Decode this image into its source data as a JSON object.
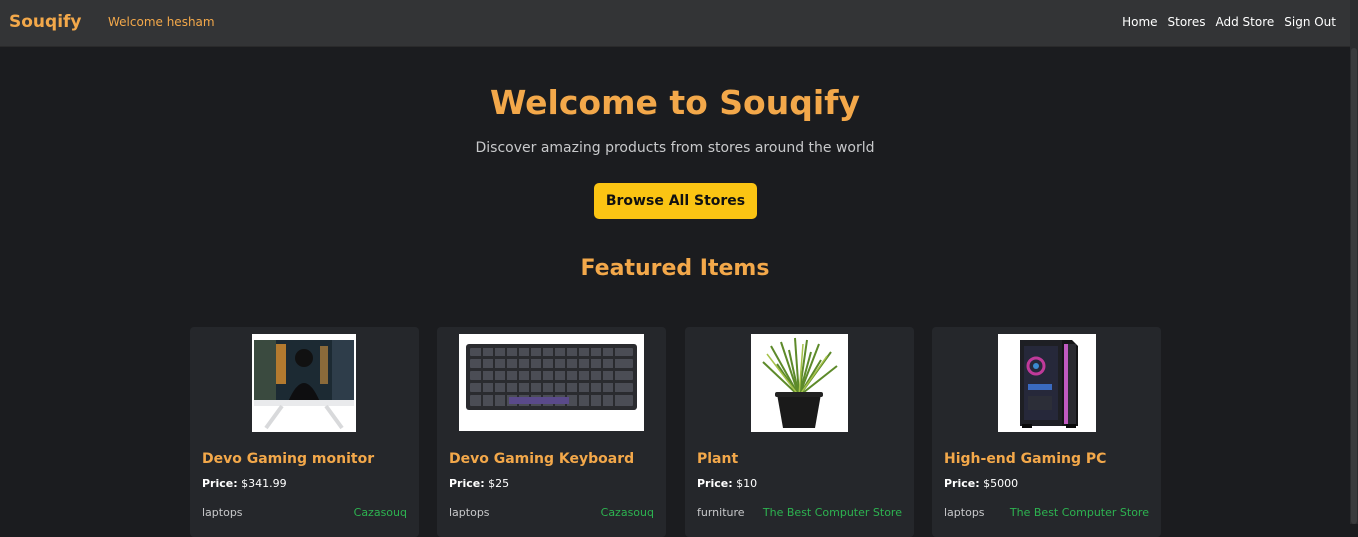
{
  "header": {
    "brand": "Souqify",
    "welcome": "Welcome hesham",
    "nav": [
      "Home",
      "Stores",
      "Add Store",
      "Sign Out"
    ]
  },
  "hero": {
    "title": "Welcome to Souqify",
    "subtitle": "Discover amazing products from stores around the world",
    "button": "Browse All Stores"
  },
  "featured": {
    "title": "Featured Items",
    "price_label": "Price:",
    "items": [
      {
        "name": "Devo Gaming monitor",
        "price": "$341.99",
        "category": "laptops",
        "store": "Cazasouq",
        "image": "gaming-monitor-image"
      },
      {
        "name": "Devo Gaming Keyboard",
        "price": "$25",
        "category": "laptops",
        "store": "Cazasouq",
        "image": "keyboard-image"
      },
      {
        "name": "Plant",
        "price": "$10",
        "category": "furniture",
        "store": "The Best Computer Store",
        "image": "plant-image"
      },
      {
        "name": "High-end Gaming PC",
        "price": "$5000",
        "category": "laptops",
        "store": "The Best Computer Store",
        "image": "gaming-pc-image"
      }
    ]
  },
  "colors": {
    "accent": "#f3a84a",
    "button": "#fbc413",
    "store_link": "#2db350",
    "background": "#1b1c1f",
    "card": "#25272b"
  }
}
